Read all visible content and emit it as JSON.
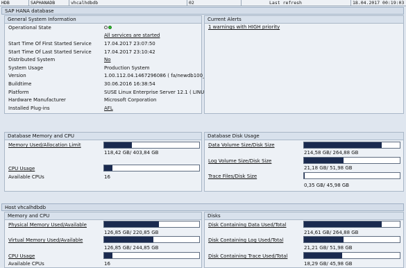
{
  "topbar": {
    "system": "HDB",
    "sid": "SAPHANADB",
    "host": "vhcalhdbdb",
    "instance": "02",
    "refresh_label": "Last refresh",
    "refresh_time": "18.04.2017 00:19:03"
  },
  "sap_hana_database": {
    "title": "SAP HANA database",
    "general": {
      "title": "General System Information",
      "rows": [
        {
          "label": "Operational State",
          "value": ""
        },
        {
          "label": "",
          "value": "All services are started"
        },
        {
          "label": "Start Time Of First Started Service",
          "value": "17.04.2017    23:07:50"
        },
        {
          "label": "Start Time Of Last Started Service",
          "value": "17.04.2017    23:10:42"
        },
        {
          "label": "Distributed System",
          "value": "No"
        },
        {
          "label": "System Usage",
          "value": "Production System"
        },
        {
          "label": "Version",
          "value": "1.00.112.04.1467296086 ( fa/newdb100_..."
        },
        {
          "label": "Buildtime",
          "value": "30.06.2016 16:38:54"
        },
        {
          "label": "Platform",
          "value": "SUSE Linux Enterprise Server 12.1 ( LINUX..."
        },
        {
          "label": "Hardware Manufacturer",
          "value": "Microsoft Corporation"
        },
        {
          "label": "Installed Plug-ins",
          "value": "AFL"
        }
      ]
    },
    "alerts": {
      "title": "Current Alerts",
      "text": "1 warnings with HIGH priority"
    },
    "memory_cpu": {
      "title": "Database Memory and CPU",
      "memory_label": "Memory Used/Allocation Limit",
      "memory_value": "118,42 GB/ 403,84 GB",
      "memory_fraction": 0.293,
      "cpu_label": "CPU Usage",
      "cpu_fraction": 0.09,
      "cpus_label": "Available CPUs",
      "cpus_value": "16"
    },
    "disk": {
      "title": "Database Disk Usage",
      "items": [
        {
          "label": "Data Volume Size/Disk Size",
          "value": "214,58 GB/ 264,88 GB",
          "fraction": 0.81
        },
        {
          "label": "Log Volume Size/Disk Size",
          "value": "21,18 GB/ 51,98 GB",
          "fraction": 0.41
        },
        {
          "label": "Trace Files/Disk Size",
          "value": "0,35 GB/ 45,98 GB",
          "fraction": 0.008
        }
      ]
    }
  },
  "host": {
    "title": "Host vhcalhdbdb",
    "memory_cpu": {
      "title": "Memory and CPU",
      "items": [
        {
          "label": "Physical Memory Used/Available",
          "value": "126,85 GB/ 220,85 GB",
          "fraction": 0.574
        },
        {
          "label": "Virtual Memory Used/Available",
          "value": "126,85 GB/ 244,85 GB",
          "fraction": 0.518
        }
      ],
      "cpu_label": "CPU Usage",
      "cpu_fraction": 0.09,
      "cpus_label": "Available CPUs",
      "cpus_value": "16"
    },
    "disks": {
      "title": "Disks",
      "items": [
        {
          "label": "Disk Containing Data Used/Total",
          "value": "214,61 GB/ 264,88 GB",
          "fraction": 0.81
        },
        {
          "label": "Disk Containing Log Used/Total",
          "value": "21,21 GB/ 51,98 GB",
          "fraction": 0.41
        },
        {
          "label": "Disk Containing Trace Used/Total",
          "value": "18,29 GB/ 45,98 GB",
          "fraction": 0.4
        }
      ]
    }
  },
  "colors": {
    "bar_fill": "#1a2a4f",
    "led_green": "#2fbf2f"
  }
}
